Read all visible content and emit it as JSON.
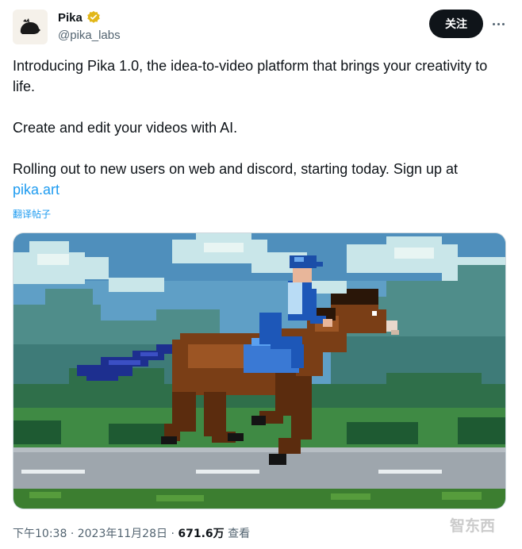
{
  "author": {
    "display_name": "Pika",
    "handle": "@pika_labs",
    "verified_color": "#e2b719"
  },
  "actions": {
    "follow_label": "关注",
    "more_icon": "more-horizontal-icon"
  },
  "tweet": {
    "line1": "Introducing Pika 1.0, the idea-to-video platform that brings your creativity to life.",
    "line2": "Create and edit your videos with AI.",
    "line3": "Rolling out to new users on web and discord, starting today. Sign up at",
    "link": "pika.art",
    "translate_label": "翻译帖子"
  },
  "media": {
    "description_icon": "pixel-art-horse-rider-video"
  },
  "meta": {
    "time": "下午10:38",
    "date": "2023年11月28日",
    "views": "671.6万",
    "views_label": "查看"
  },
  "watermark": "智东西",
  "colors": {
    "text": "#0f1419",
    "secondary": "#536471",
    "link": "#1d9bf0",
    "button_bg": "#0f1419"
  }
}
